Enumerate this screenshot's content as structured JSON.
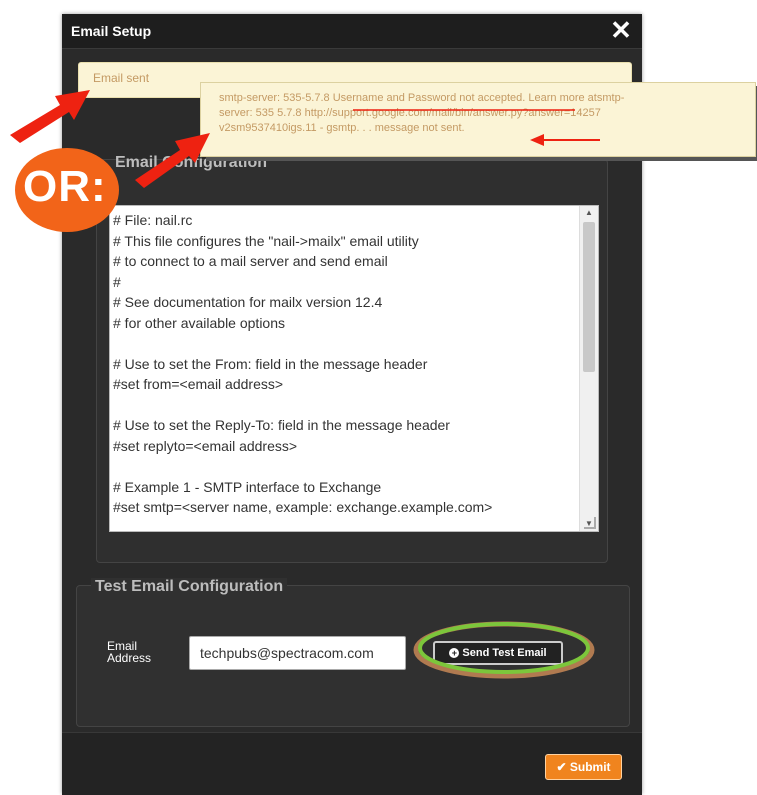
{
  "dialog": {
    "title": "Email Setup",
    "close_icon": "close-icon",
    "status_message": "Email sent",
    "config_legend": "Email Configuration",
    "config_text_lines": [
      "# File: nail.rc",
      "# This file configures the \"nail->mailx\" email utility",
      "# to connect to a mail server and send email",
      "#",
      "# See documentation for mailx version 12.4",
      "# for other available options",
      "",
      "# Use to set the From: field in the message header",
      "#set from=<email address>",
      "",
      "# Use to set the Reply-To: field in the message header",
      "#set replyto=<email address>",
      "",
      "# Example 1 - SMTP interface to Exchange",
      "#set smtp=<server name, example: exchange.example.com>"
    ],
    "test_legend": "Test Email Configuration",
    "email_label_line1": "Email",
    "email_label_line2": "Address",
    "email_value": "techpubs@spectracom.com",
    "send_test_label": "Send Test Email",
    "submit_label": "Submit"
  },
  "annotation": {
    "callout_lines": [
      "smtp-server: 535-5.7.8 Username and Password not accepted. Learn more atsmtp-",
      "server: 535 5.7.8 http://support.google.com/mail/bin/answer.py?answer=14257",
      "v2sm9537410igs.11 - gsmtp. . . message not sent."
    ],
    "or_label": "OR:"
  },
  "colors": {
    "arrow_red": "#ee2211",
    "badge_orange": "#f26419",
    "submit_orange": "#f0841e",
    "highlight_green": "#7cc63b",
    "message_text": "#c49a64"
  }
}
